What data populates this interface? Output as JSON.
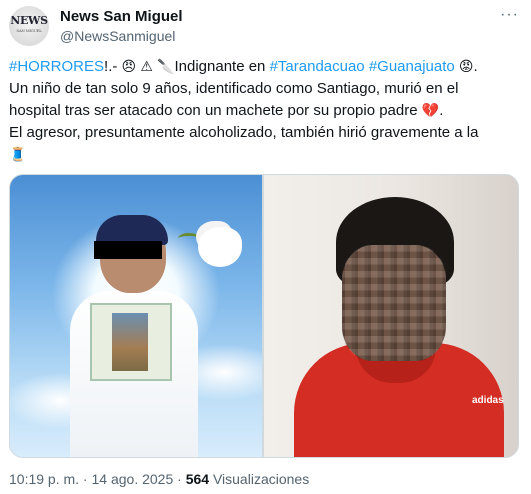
{
  "account": {
    "name": "News San Miguel",
    "handle": "@NewsSanmiguel",
    "avatar_text": "NEWS",
    "avatar_subtext": "SAN MIGUEL"
  },
  "menu_icon": "more-horizontal-icon",
  "tweet": {
    "hashtag1": "#HORRORES",
    "text1": "!.- ",
    "emoji_angry_face": "😠",
    "emoji_warning": "⚠",
    "emoji_knife": "🔪",
    "text2": "Indignante en ",
    "hashtag2": "#Tarandacuao",
    "hashtag3": "#Guanajuato",
    "emoji_rage": "😡",
    "text3": ".",
    "line2": "Un niño de tan solo 9 años, identificado como Santiago, murió en el",
    "line3": "hospital tras ser atacado con un machete por su propio padre",
    "emoji_broken_heart": "💔",
    "line3_end": ".",
    "line4": "El agresor, presuntamente alcoholizado, también hirió gravemente a la",
    "emoji_spool": "🧵"
  },
  "media": {
    "image1_icon": "memorial-photo-icon",
    "image2_icon": "boy-photo-icon",
    "image2_brand": "adidas"
  },
  "footer": {
    "time": "10:19 p. m.",
    "sep1": " · ",
    "date": "14 ago. 2025",
    "sep2": " · ",
    "views_count": "564",
    "views_label": " Visualizaciones"
  },
  "colors": {
    "link": "#1d9bf0",
    "text": "#0f1419",
    "secondary": "#536471"
  }
}
